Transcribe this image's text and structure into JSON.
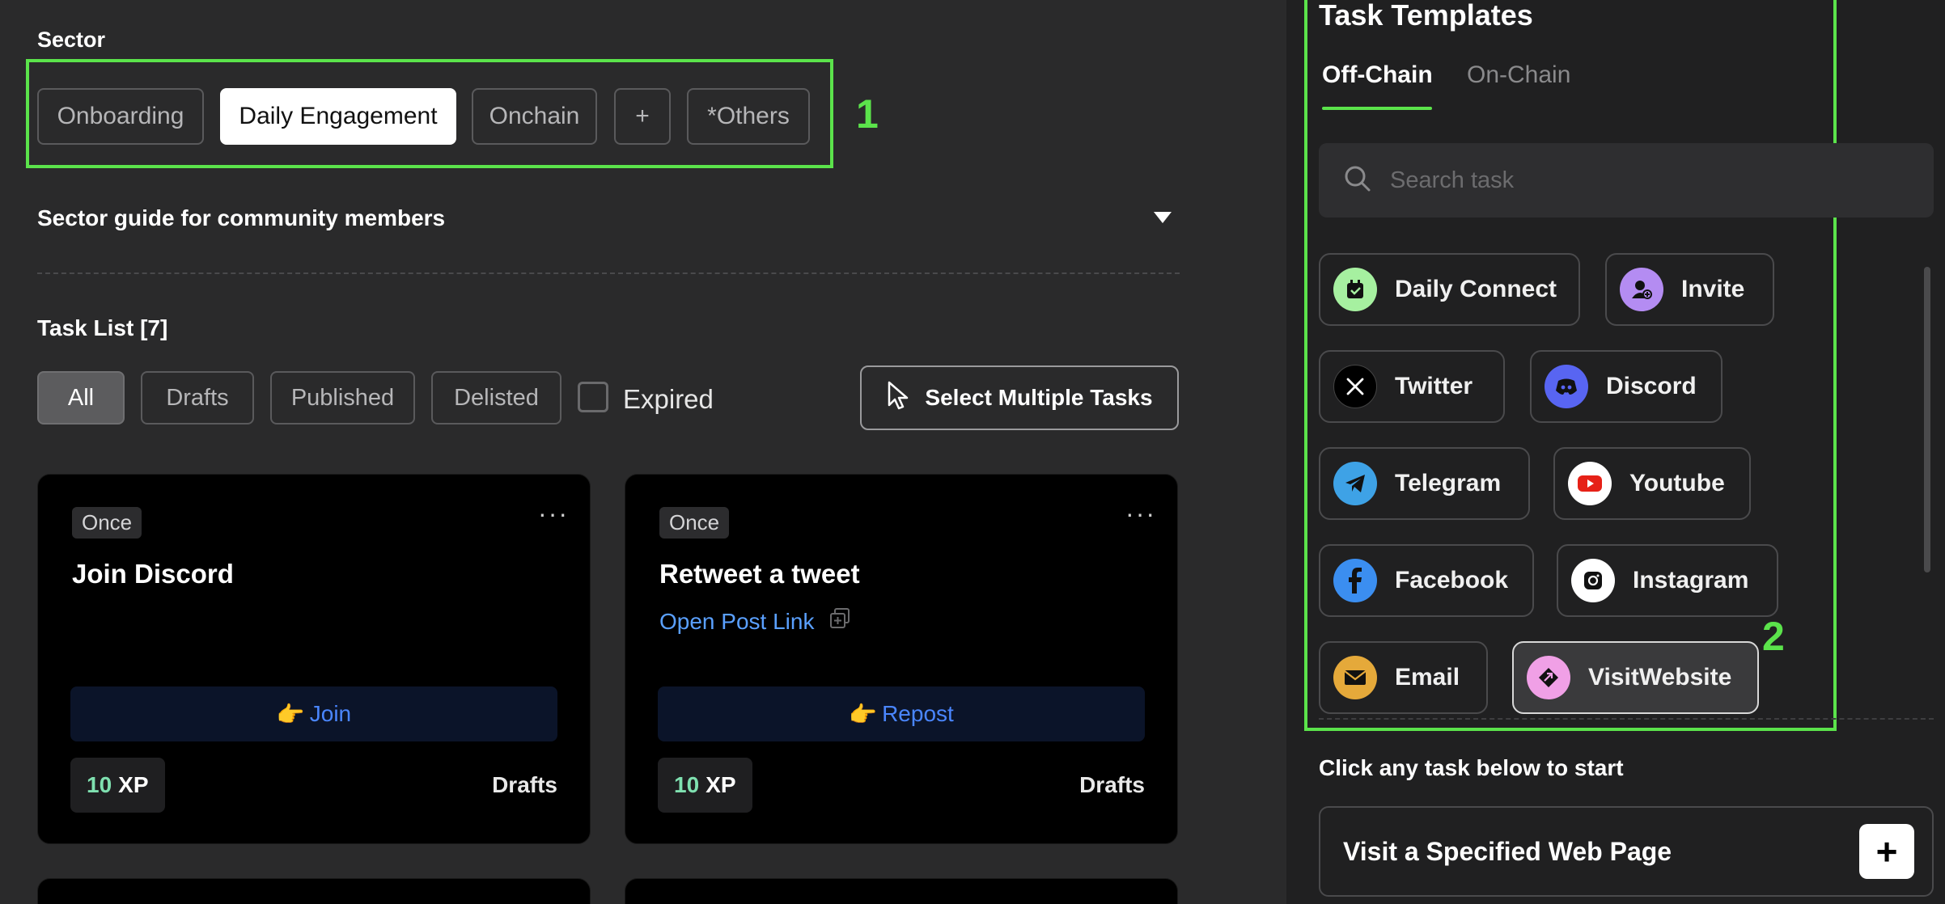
{
  "sector": {
    "title": "Sector",
    "chips": [
      "Onboarding",
      "Daily Engagement",
      "Onchain",
      "+",
      "*Others"
    ],
    "active": "Daily Engagement",
    "callout": "1"
  },
  "guide": {
    "label": "Sector guide for community members"
  },
  "task_list": {
    "title": "Task List [7]",
    "filters": [
      "All",
      "Drafts",
      "Published",
      "Delisted"
    ],
    "active_filter": "All",
    "expired_label": "Expired",
    "expired_checked": false,
    "select_multiple_label": "Select Multiple Tasks"
  },
  "cards": [
    {
      "badge": "Once",
      "menu": "···",
      "title": "Join Discord",
      "link": "",
      "action_emoji": "👉",
      "action": "Join",
      "xp_value": "10",
      "xp_unit": "XP",
      "status": "Drafts"
    },
    {
      "badge": "Once",
      "menu": "···",
      "title": "Retweet a tweet",
      "link": "Open Post Link",
      "action_emoji": "👉",
      "action": "Repost",
      "xp_value": "10",
      "xp_unit": "XP",
      "status": "Drafts"
    }
  ],
  "templates": {
    "title": "Task Templates",
    "tabs": [
      "Off-Chain",
      "On-Chain"
    ],
    "active_tab": "Off-Chain",
    "search_placeholder": "Search task",
    "callout": "2",
    "items": [
      {
        "label": "Daily Connect",
        "icon": "calendar-check-icon",
        "color": "#a6f0a0"
      },
      {
        "label": "Invite",
        "icon": "invite-user-icon",
        "color": "#b48cf2"
      },
      {
        "label": "Twitter",
        "icon": "x-logo-icon",
        "color": "#000000"
      },
      {
        "label": "Discord",
        "icon": "discord-icon",
        "color": "#5865f2"
      },
      {
        "label": "Telegram",
        "icon": "telegram-icon",
        "color": "#3ea2e6"
      },
      {
        "label": "Youtube",
        "icon": "youtube-icon",
        "color": "#ffffff"
      },
      {
        "label": "Facebook",
        "icon": "facebook-icon",
        "color": "#3b8ef0"
      },
      {
        "label": "Instagram",
        "icon": "instagram-icon",
        "color": "#ffffff"
      },
      {
        "label": "Email",
        "icon": "email-icon",
        "color": "#e5a93a"
      },
      {
        "label": "VisitWebsite",
        "icon": "visit-website-icon",
        "color": "#f0a0e6",
        "selected": true
      }
    ]
  },
  "start": {
    "hint": "Click any task below to start",
    "selected_task": "Visit a Specified Web Page",
    "add_label": "+"
  },
  "colors": {
    "accent_green": "#5be34b",
    "link_blue": "#5aa0ff",
    "xp_green": "#7fe0b0"
  }
}
